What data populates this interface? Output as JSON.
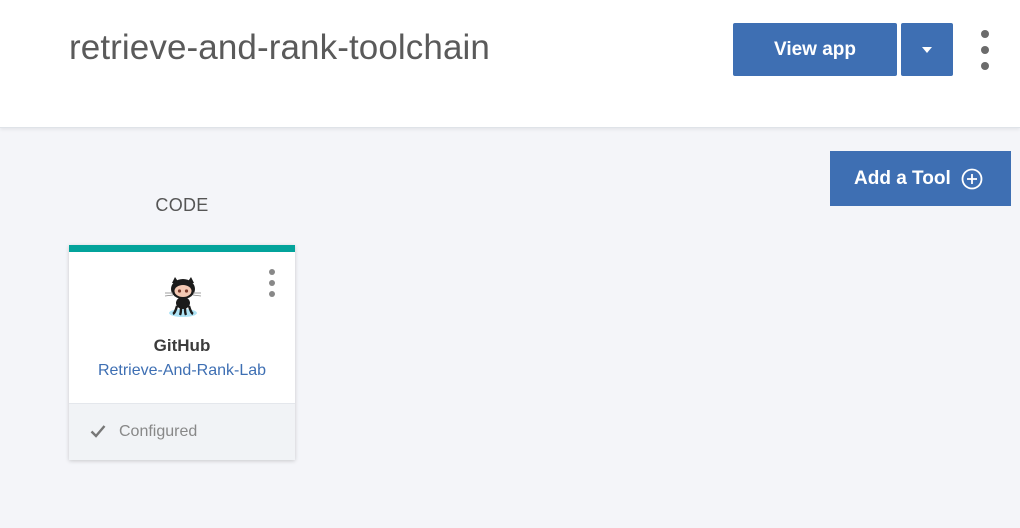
{
  "header": {
    "title": "retrieve-and-rank-toolchain",
    "view_app_label": "View app"
  },
  "toolbar": {
    "add_tool_label": "Add a Tool"
  },
  "section": {
    "label": "CODE"
  },
  "card": {
    "name": "GitHub",
    "repo": "Retrieve-And-Rank-Lab",
    "status": "Configured",
    "accent_color": "#03a39b"
  },
  "colors": {
    "primary": "#3e6fb3",
    "background": "#f4f5f9"
  },
  "icons": [
    "chevron-down-icon",
    "kebab-menu-icon",
    "plus-circle-icon",
    "github-octocat-icon",
    "checkmark-icon"
  ]
}
